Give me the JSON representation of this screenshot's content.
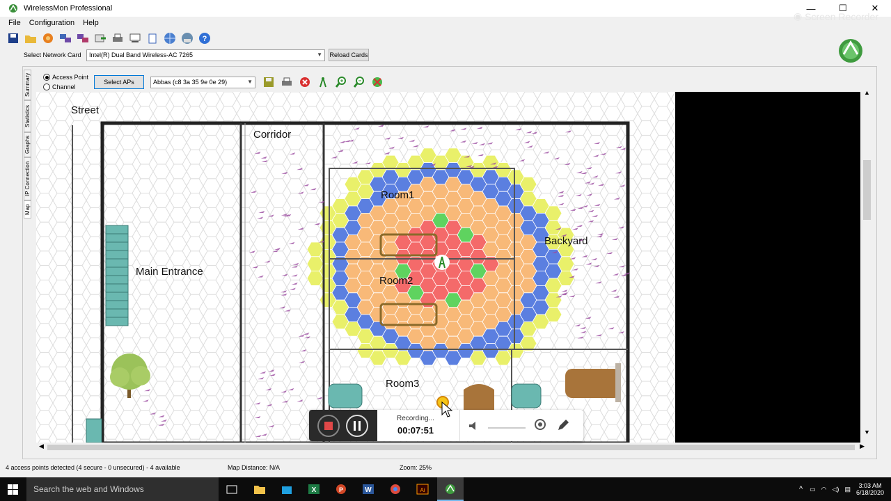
{
  "window": {
    "title": "WirelessMon Professional",
    "minimize": "—",
    "maximize": "☐",
    "close": "✕"
  },
  "watermark": "Screen Recorder",
  "menu": [
    "File",
    "Configuration",
    "Help"
  ],
  "toolbar_icons": [
    "save-icon",
    "open-folder-icon",
    "record-icon",
    "network-icon",
    "network-alt-icon",
    "export-icon",
    "print-icon",
    "monitor-icon",
    "clipboard-icon",
    "globe-icon",
    "web-icon",
    "help-icon"
  ],
  "network": {
    "label": "Select Network Card",
    "value": "Intel(R) Dual Band Wireless-AC 7265",
    "reload": "Reload Cards"
  },
  "vtabs": [
    "Summary",
    "Statistics",
    "Graphs",
    "IP Connection",
    "Map"
  ],
  "map_toolbar": {
    "radio_access_point": "Access Point",
    "radio_channel": "Channel",
    "selected": "Access Point",
    "select_aps": "Select APs",
    "ap_value": "Abbas (c8 3a 35 9e 0e 29)"
  },
  "map": {
    "street": "Street",
    "corridor": "Corridor",
    "room1": "Room1",
    "room2": "Room2",
    "room3": "Room3",
    "backyard": "Backyard",
    "main_entrance": "Main Entrance"
  },
  "status": {
    "aps": "4 access points detected (4 secure - 0 unsecured) - 4 available",
    "distance": "Map Distance: N/A",
    "zoom": "Zoom: 25%"
  },
  "recording": {
    "label": "Recording...",
    "time": "00:07:51"
  },
  "taskbar": {
    "search": "Search the web and Windows",
    "time": "3:03 AM",
    "date": "6/18/2020"
  },
  "colors": {
    "strong": "#f46a6a",
    "good": "#5fd35f",
    "fair": "#f8b978",
    "weak": "#5b7fe0",
    "poor": "#e9f06a"
  }
}
